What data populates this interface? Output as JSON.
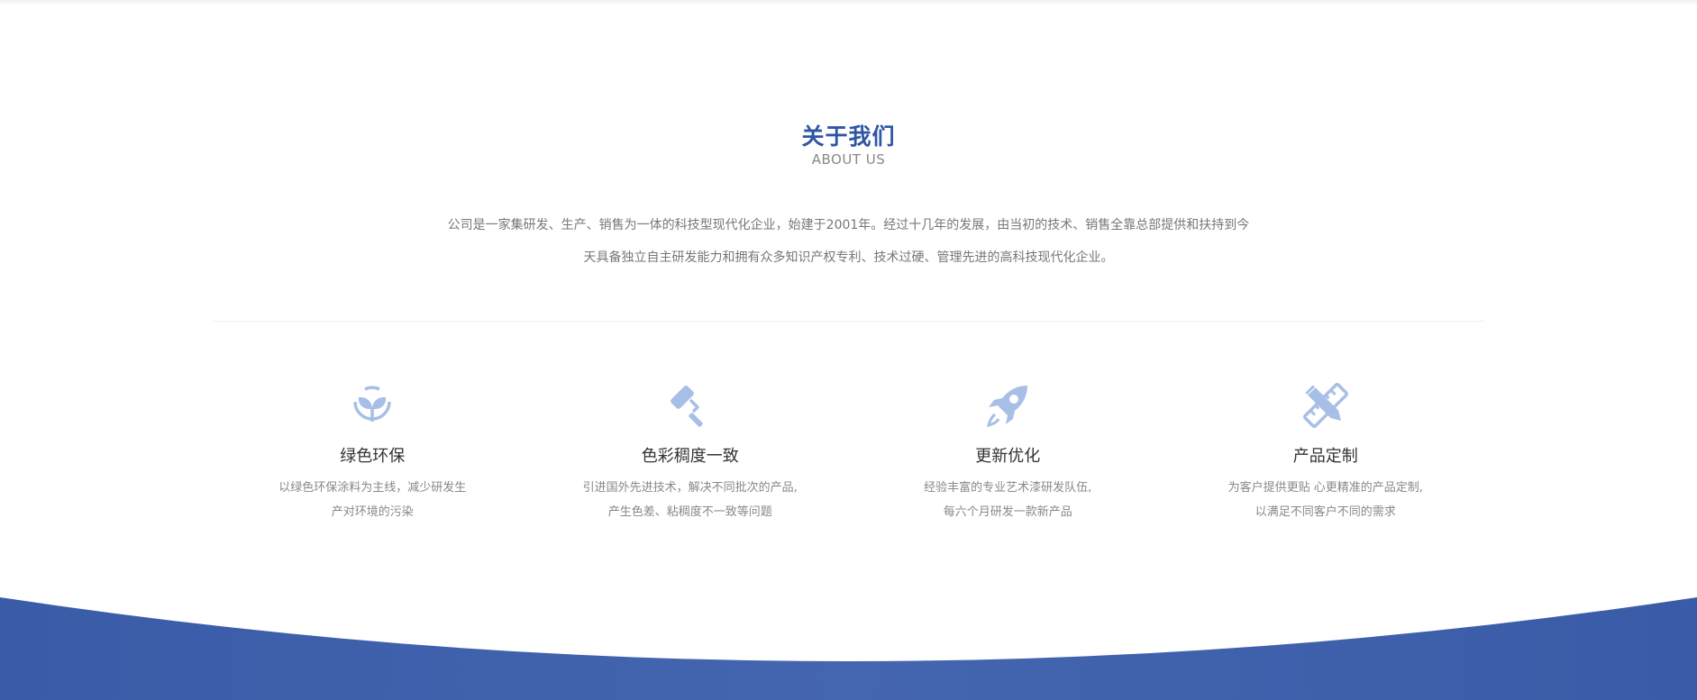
{
  "about": {
    "title": "关于我们",
    "subtitle": "ABOUT US",
    "intro_line1": "公司是一家集研发、生产、销售为一体的科技型现代化企业，始建于2001年。经过十几年的发展，由当初的技术、销售全靠总部提供和扶持到今",
    "intro_line2": "天具备独立自主研发能力和拥有众多知识产权专利、技术过硬、管理先进的高科技现代化企业。"
  },
  "features": [
    {
      "icon": "leaf-sprout-icon",
      "title": "绿色环保",
      "desc_line1": "以绿色环保涂料为主线，减少研发生",
      "desc_line2": "产对环境的污染"
    },
    {
      "icon": "paint-roller-icon",
      "title": "色彩稠度一致",
      "desc_line1": "引进国外先进技术，解决不同批次的产品,",
      "desc_line2": "产生色差、粘稠度不一致等问题"
    },
    {
      "icon": "rocket-icon",
      "title": "更新优化",
      "desc_line1": "经验丰富的专业艺术漆研发队伍,",
      "desc_line2": "每六个月研发一款新产品"
    },
    {
      "icon": "pencil-ruler-icon",
      "title": "产品定制",
      "desc_line1": "为客户提供更贴 心更精准的产品定制,",
      "desc_line2": "以满足不同客户不同的需求"
    }
  ],
  "colors": {
    "accent": "#2f56a3",
    "icon": "#a7bfe6",
    "wave": "#3d5fa8"
  }
}
